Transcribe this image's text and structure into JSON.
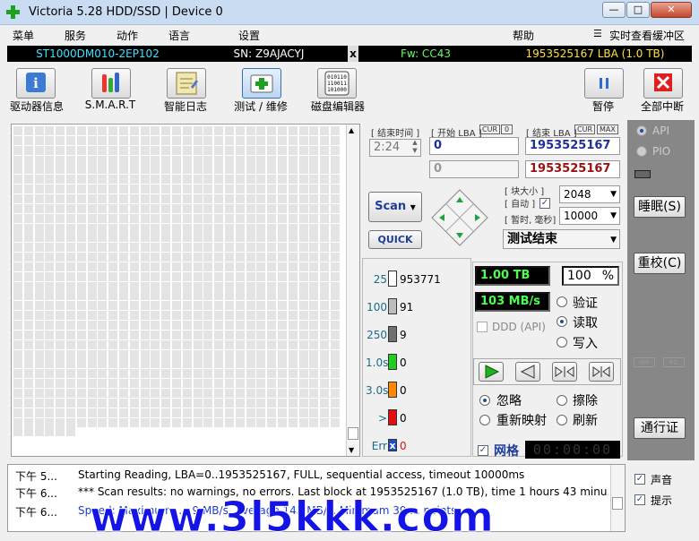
{
  "window": {
    "title": "Victoria 5.28 HDD/SSD | Device 0",
    "min": "—",
    "max": "□",
    "close": "✕"
  },
  "menu": {
    "items": [
      "菜单",
      "服务",
      "动作",
      "语言",
      "设置"
    ],
    "help": "帮助",
    "live_cache": "实时查看缓冲区"
  },
  "drive_info": {
    "model": "ST1000DM010-2EP102",
    "serial": "SN: Z9AJACYJ",
    "sep": "x",
    "firmware": "Fw: CC43",
    "capacity": "1953525167 LBA (1.0 TB)"
  },
  "toolbar": {
    "drive_info": "驱动器信息",
    "smart": "S.M.A.R.T",
    "smart_log": "智能日志",
    "test_repair": "测试 / 维修",
    "disk_editor": "磁盘编辑器",
    "pause": "暂停",
    "stop_all": "全部中断"
  },
  "scan": {
    "end_time_label": "[ 结束时间 ]",
    "start_lba_label": "[ 开始 LBA ]",
    "cur_label": "CUR",
    "zero_label": "0",
    "end_lba_label": "[ 结束 LBA ]",
    "max_label": "MAX",
    "end_time": "2:24",
    "start_lba": "0",
    "end_lba": "1953525167",
    "cur_lba": "0",
    "cur_end_lba": "1953525167",
    "scan_button": "Scan",
    "quick_button": "QUICK",
    "block_size_label": "[ 块大小 ]",
    "auto_label": "[ 自动 ]",
    "timeout_label": "[ 暂时, 毫秒]",
    "block_size": "2048",
    "timeout": "10000",
    "status": "测试结束"
  },
  "stats": {
    "rows": [
      {
        "ms": "25",
        "count": "953771",
        "color": "#ffffff"
      },
      {
        "ms": "100",
        "count": "91",
        "color": "#bdbdbd"
      },
      {
        "ms": "250",
        "count": "9",
        "color": "#707070"
      },
      {
        "ms": "1.0s",
        "count": "0",
        "color": "#22cc22"
      },
      {
        "ms": "3.0s",
        "count": "0",
        "color": "#ff8800"
      },
      {
        "ms": ">",
        "count": "0",
        "color": "#e01010"
      },
      {
        "ms": "Err",
        "count": "0",
        "color": "#1f4ec8"
      }
    ],
    "err_mark": "x"
  },
  "progress": {
    "size": "1.00 TB",
    "percent": "100",
    "percent_sign": "%",
    "speed": "103 MB/s",
    "ddd_api": "DDD (API)",
    "mode_verify": "验证",
    "mode_read": "读取",
    "mode_write": "写入",
    "action_ignore": "忽略",
    "action_erase": "擦除",
    "action_remap": "重新映射",
    "action_refresh": "刷新",
    "grid_label": "网格",
    "timer": "00:00:00"
  },
  "side": {
    "api": "API",
    "pio": "PIO",
    "sleep": "睡眠(S)",
    "recalibrate": "重校(C)",
    "wr": "WR",
    "rd": "RD",
    "passport": "通行证"
  },
  "log": {
    "rows": [
      {
        "time": "下午 5...",
        "msg": "Starting Reading, LBA=0..1953525167, FULL, sequential access, timeout 10000ms"
      },
      {
        "time": "下午 6...",
        "msg": "*** Scan results: no warnings, no errors. Last block at 1953525167 (1.0 TB), time 1 hours 43 minu..."
      },
      {
        "time": "下午 6...",
        "msg": "Speed: Maximum ... ,9 MB/s. Average 145 MB/s. Minimum 39 ... points"
      }
    ],
    "sound": "声音",
    "hint": "提示"
  },
  "watermark": "www.3l5kkk.com"
}
